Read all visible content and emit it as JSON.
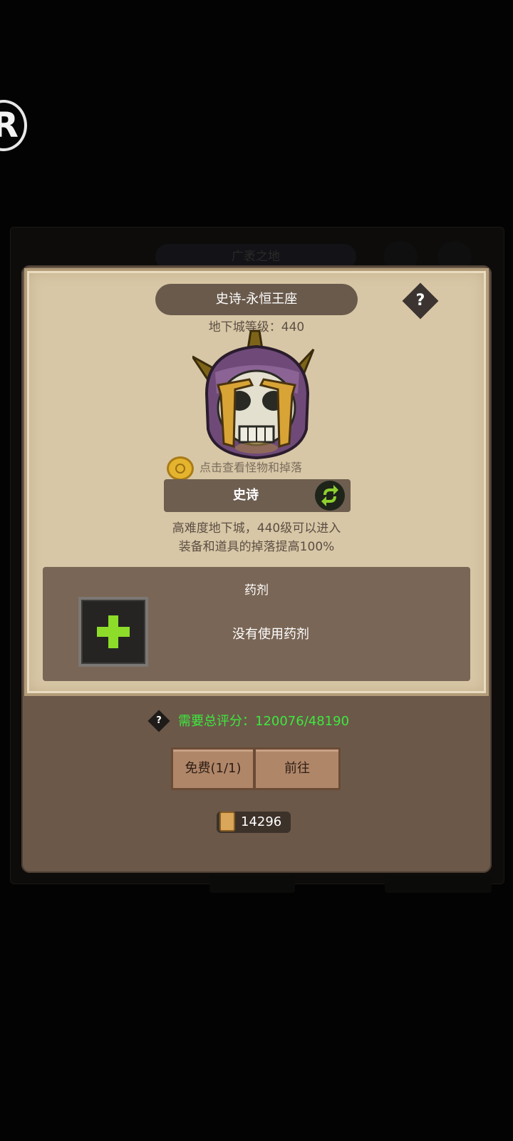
{
  "background": {
    "tab_text": "广袤之地"
  },
  "side_badge": {
    "letter": "R"
  },
  "dialog": {
    "title": "史诗-永恒王座",
    "help_icon": "?",
    "dungeon_level": "地下城等级：440",
    "loot_hint": "点击查看怪物和掉落",
    "difficulty_label": "史诗",
    "description_line1": "高难度地下城，440级可以进入",
    "description_line2": "装备和道具的掉落提高100%",
    "potion": {
      "title": "药剂",
      "empty_text": "没有使用药剂"
    },
    "requirement": {
      "help_icon": "?",
      "text": "需要总评分：120076/48190",
      "color": "#3ee83e"
    },
    "buttons": {
      "free_label": "免费(1/1)",
      "go_label": "前往"
    },
    "scroll_count": "14296"
  }
}
